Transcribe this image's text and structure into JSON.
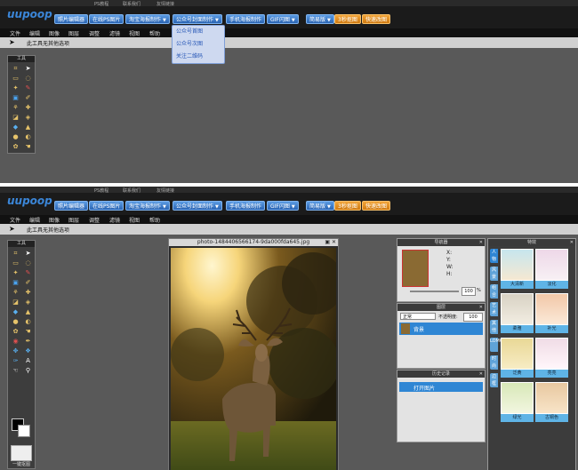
{
  "top_links": [
    "PS教程",
    "联系我们",
    "友情链接"
  ],
  "logo": "uupoop",
  "nav": {
    "items": [
      {
        "label": "照片编辑器",
        "dropdown": false
      },
      {
        "label": "在线PS图片",
        "dropdown": false
      },
      {
        "label": "淘宝海报制作",
        "dropdown": true
      },
      {
        "label": "公众号封面制作",
        "dropdown": true
      },
      {
        "label": "手机海报制作",
        "dropdown": false
      },
      {
        "label": "GIF闪图",
        "dropdown": true
      },
      {
        "label": "简易版",
        "dropdown": true
      },
      {
        "label": "3秒抠图",
        "dropdown": false
      },
      {
        "label": "快速改图",
        "dropdown": false
      }
    ],
    "caret": "▼"
  },
  "menu": [
    "文件",
    "编辑",
    "图像",
    "图层",
    "调整",
    "滤镜",
    "视图",
    "帮助"
  ],
  "options_bar": {
    "hint": "此工具无其他选项"
  },
  "dropdown_menu": [
    "公众号首图",
    "公众号次图",
    "关注二维码"
  ],
  "tools": {
    "title": "工具",
    "one_click_label": "一键抠图"
  },
  "document": {
    "title": "photo-1484406566174-9da000fda645.jpg",
    "controls": "▣ ✕"
  },
  "navigator": {
    "title": "导航器",
    "x_label": "X:",
    "y_label": "Y:",
    "w_label": "W:",
    "h_label": "H:",
    "zoom": "100",
    "zoom_unit": "%"
  },
  "layers": {
    "title": "图层",
    "mode": "正常",
    "opacity_label": "不透明度:",
    "opacity": "100",
    "layer_name": "背景"
  },
  "history": {
    "title": "历史记录",
    "item": "打开图片"
  },
  "effects": {
    "title": "特效",
    "tabs": [
      "人物",
      "风景",
      "组合",
      "艺术",
      "其他",
      "LOMO",
      "时尚",
      "边框"
    ],
    "items": [
      "大清新",
      "淡化",
      "柔雅",
      "补光",
      "泛黄",
      "亮亮",
      "绿光",
      "古铜色"
    ]
  },
  "colors": {
    "accent": "#2a64b3",
    "orange": "#d07a10",
    "bg": "#595959",
    "effect_label": "#5fb4e6"
  }
}
